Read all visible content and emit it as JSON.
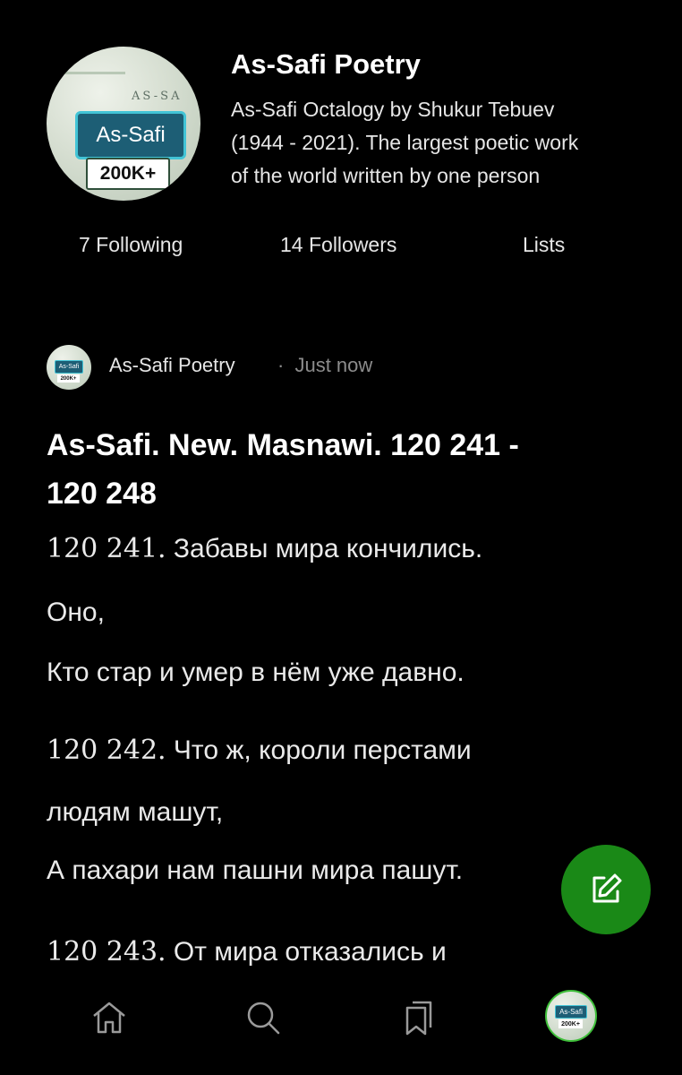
{
  "profile": {
    "name": "As-Safi Poetry",
    "description_lines": [
      "As-Safi Octalogy by Shukur Tebuev",
      "(1944 - 2021). The largest poetic work",
      "of the world written by one person"
    ],
    "avatar_banner_text": "As-Safi",
    "avatar_count_text": "200K+",
    "stats": {
      "following": "7 Following",
      "followers": "14 Followers",
      "lists": "Lists"
    }
  },
  "post": {
    "author": "As-Safi Poetry",
    "separator": "·",
    "time": "Just now",
    "title_lines": [
      "As-Safi. New. Masnawi. 120 241 -",
      "120 248"
    ],
    "verses": [
      {
        "num": "120 241.",
        "text": " Забавы мира кончились."
      },
      {
        "num": "",
        "text": "Оно,"
      },
      {
        "num": "",
        "text": "Кто стар и умер в нём уже давно."
      },
      {
        "num": "120 242.",
        "text": " Что ж, короли перстами"
      },
      {
        "num": "",
        "text": "людям машут,"
      },
      {
        "num": "",
        "text": "А пахари нам пашни мира пашут."
      },
      {
        "num": "120 243.",
        "text": " От мира отказались и"
      }
    ]
  },
  "fab": {
    "icon": "edit-icon",
    "color": "#1a8917"
  },
  "nav": {
    "items": [
      "home-icon",
      "search-icon",
      "bookmarks-icon",
      "profile-avatar"
    ],
    "avatar_banner_text": "As-Safi",
    "avatar_count_text": "200K+",
    "active_ring_color": "#3fbf3a"
  }
}
